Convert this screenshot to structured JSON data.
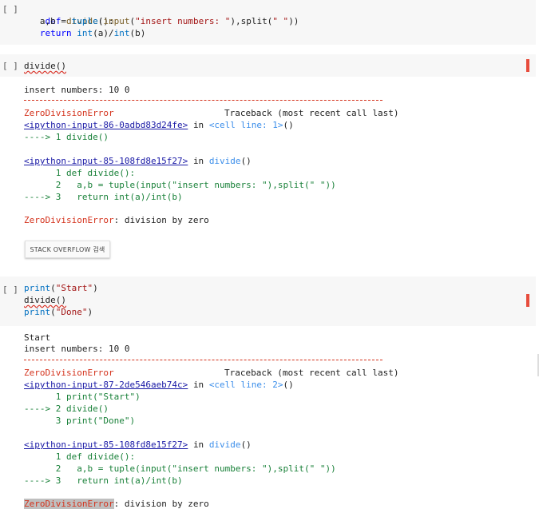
{
  "cells": [
    {
      "marker": "[ ]",
      "code": [
        "def divide():",
        "  a,b = tuple(input(\"insert numbers: \"),split(\" \"))",
        "  return int(a)/int(b)"
      ]
    },
    {
      "marker": "[ ]",
      "code": [
        "divide()"
      ],
      "output": {
        "stdout": [
          "insert numbers: 10 0"
        ],
        "error_name": "ZeroDivisionError",
        "traceback_header": "Traceback (most recent call last)",
        "frame1_link": "<ipython-input-86-0adbd83d24fe>",
        "frame1_in": "in",
        "frame1_loc": "<cell line: 1>",
        "frame1_paren": "()",
        "frame1_lines": [
          "----> 1 divide()"
        ],
        "frame2_link": "<ipython-input-85-108fd8e15f27>",
        "frame2_in": "in",
        "frame2_loc": "divide",
        "frame2_paren": "()",
        "frame2_lines": [
          "      1 def divide():",
          "      2   a,b = tuple(input(\"insert numbers: \"),split(\" \"))",
          "----> 3   return int(a)/int(b)"
        ],
        "error_msg": ": division by zero",
        "so_button": "STACK OVERFLOW 검색"
      }
    },
    {
      "marker": "[ ]",
      "code": [
        "print(\"Start\")",
        "divide()",
        "print(\"Done\")"
      ],
      "output": {
        "stdout": [
          "Start",
          "insert numbers: 10 0"
        ],
        "error_name": "ZeroDivisionError",
        "traceback_header": "Traceback (most recent call last)",
        "frame1_link": "<ipython-input-87-2de546aeb74c>",
        "frame1_in": "in",
        "frame1_loc": "<cell line: 2>",
        "frame1_paren": "()",
        "frame1_lines": [
          "      1 print(\"Start\")",
          "----> 2 divide()",
          "      3 print(\"Done\")"
        ],
        "frame2_link": "<ipython-input-85-108fd8e15f27>",
        "frame2_in": "in",
        "frame2_loc": "divide",
        "frame2_paren": "()",
        "frame2_lines": [
          "      1 def divide():",
          "      2   a,b = tuple(input(\"insert numbers: \"),split(\" \"))",
          "----> 3   return int(a)/int(b)"
        ],
        "error_msg": ": division by zero"
      }
    }
  ],
  "colors": {
    "error": "#d4321c",
    "link": "#1a1aa6",
    "cell_bg": "#f7f7f7",
    "run_indicator": "#e74c3c"
  }
}
